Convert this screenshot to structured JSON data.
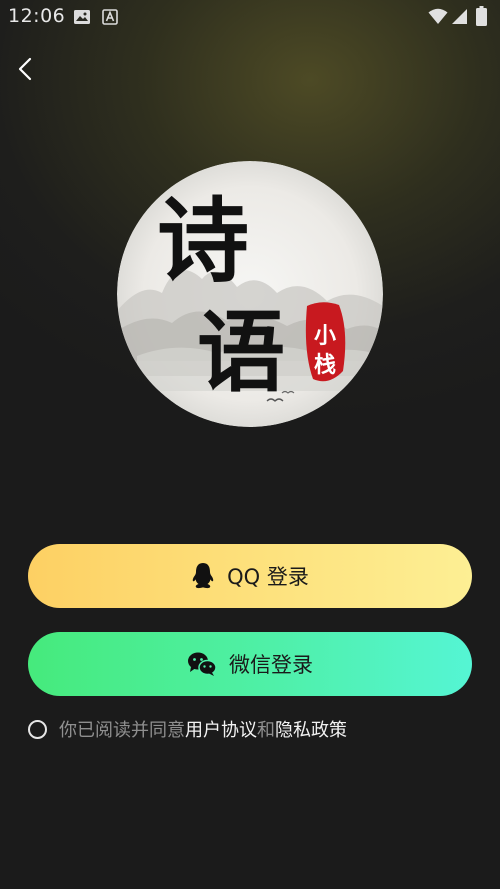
{
  "status_bar": {
    "time": "12:06"
  },
  "logo": {
    "text_main_1": "诗",
    "text_main_2": "语",
    "seal_1": "小",
    "seal_2": "栈"
  },
  "login": {
    "qq_label": "QQ 登录",
    "wechat_label": "微信登录"
  },
  "agreement": {
    "prefix": "你已阅读并同意 ",
    "user_agreement": "用户协议",
    "and": " 和 ",
    "privacy_policy": "隐私政策"
  },
  "colors": {
    "qq_button_start": "#fdd063",
    "qq_button_end": "#fdef94",
    "wechat_button_start": "#46ea7c",
    "wechat_button_end": "#55f5d4",
    "seal_red": "#c8191f"
  },
  "icons": [
    "image-icon",
    "a-icon",
    "wifi-icon",
    "signal-icon",
    "battery-icon",
    "back-arrow-icon",
    "qq-penguin-icon",
    "wechat-icon"
  ]
}
